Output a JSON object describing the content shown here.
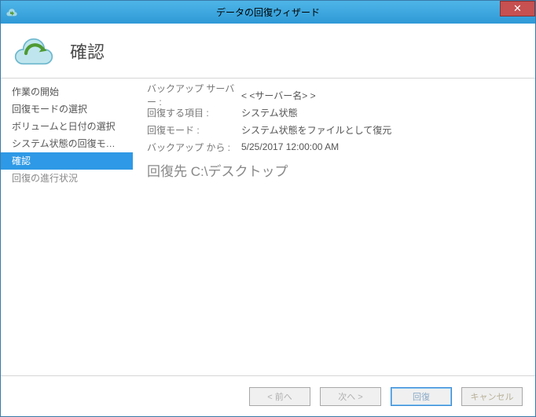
{
  "window": {
    "title": "データの回復ウィザード"
  },
  "header": {
    "title": "確認"
  },
  "sidebar": {
    "items": [
      {
        "label": "作業の開始",
        "state": "normal"
      },
      {
        "label": "回復モードの選択",
        "state": "normal"
      },
      {
        "label": "ボリュームと日付の選択",
        "state": "normal"
      },
      {
        "label": "システム状態の回復モードの...",
        "state": "normal"
      },
      {
        "label": "確認",
        "state": "active"
      },
      {
        "label": "回復の進行状況",
        "state": "dimmed"
      }
    ]
  },
  "details": {
    "rows": [
      {
        "label": "バックアップ サーバー :",
        "value": "< <サーバー名> >"
      },
      {
        "label": "回復する項目 :",
        "value": "システム状態"
      },
      {
        "label": "回復モード :",
        "value": "システム状態をファイルとして復元"
      },
      {
        "label": "バックアップ から :",
        "value": "5/25/2017 12:00:00 AM"
      }
    ],
    "recover_to": "回復先 C:\\デスクトップ"
  },
  "buttons": {
    "back": "< 前へ",
    "next": "次へ >",
    "recover": "回復",
    "cancel": "キャンセル"
  },
  "icons": {
    "app": "cloud-recovery-icon",
    "close": "✕"
  }
}
